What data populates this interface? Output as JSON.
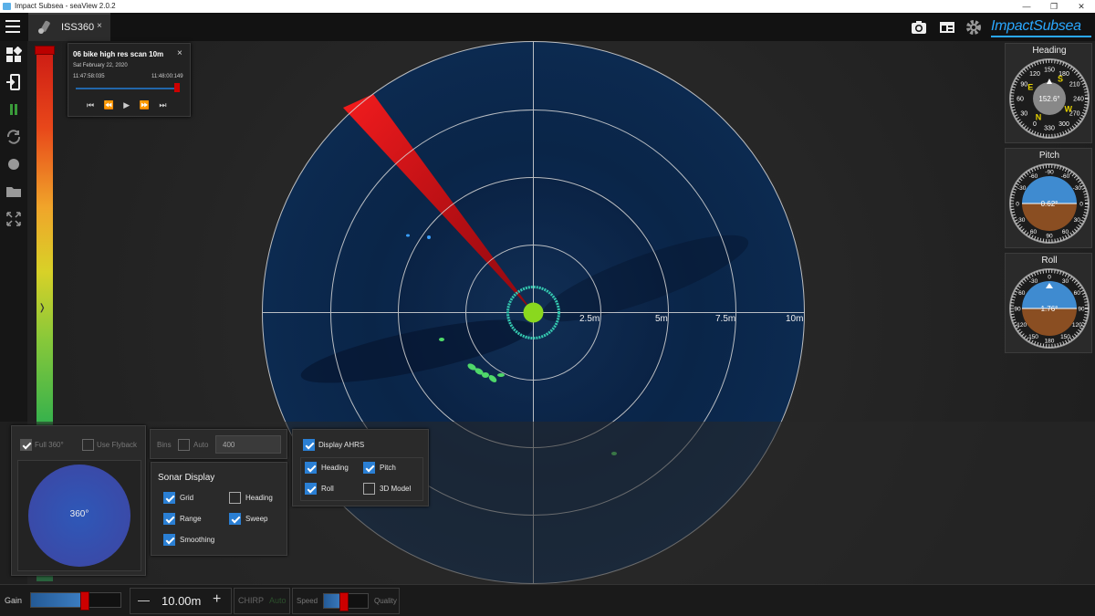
{
  "window": {
    "title": "Impact Subsea - seaView 2.0.2"
  },
  "tab": {
    "label": "ISS360",
    "close": "×"
  },
  "brand": {
    "name": "ImpactSubsea"
  },
  "player": {
    "title": "06 bike high res scan 10m",
    "date": "Sat February 22, 2020",
    "start_time": "11:47:58:035",
    "end_time": "11:48:00:149",
    "close": "×",
    "progress": 0.97,
    "controls": "⏮ ⏪ ▶ ⏩ ⏭"
  },
  "sonar": {
    "range_labels": [
      "2.5m",
      "5m",
      "7.5m",
      "10m"
    ],
    "sweep_color": "#cc1111"
  },
  "ahrs": {
    "heading": {
      "title": "Heading",
      "value": "152.6°",
      "ticks": [
        "120",
        "150",
        "180",
        "210",
        "240",
        "270",
        "300",
        "330",
        "0",
        "30",
        "60",
        "90"
      ],
      "cardinals": [
        "S",
        "W",
        "N",
        "E"
      ]
    },
    "pitch": {
      "title": "Pitch",
      "value": "0.62°",
      "ticks": [
        "-90",
        "-60",
        "-30",
        "0",
        "30",
        "60",
        "90"
      ]
    },
    "roll": {
      "title": "Roll",
      "value": "1.76°",
      "ticks": [
        "-30",
        "0",
        "30",
        "60",
        "90",
        "120",
        "150",
        "180",
        "150",
        "120",
        "90",
        "60"
      ]
    }
  },
  "scan_panel": {
    "full360_label": "Full 360°",
    "flyback_label": "Use Flyback",
    "sector_label": "360°"
  },
  "bins_panel": {
    "bins_label": "Bins",
    "auto_label": "Auto",
    "bins_value": "400"
  },
  "sonar_display": {
    "title": "Sonar Display",
    "items": [
      {
        "label": "Grid",
        "checked": true
      },
      {
        "label": "Heading",
        "checked": false
      },
      {
        "label": "Range",
        "checked": true
      },
      {
        "label": "Sweep",
        "checked": true
      },
      {
        "label": "Smoothing",
        "checked": true
      }
    ]
  },
  "ahrs_panel": {
    "display_label": "Display AHRS",
    "items": [
      {
        "label": "Heading",
        "checked": true
      },
      {
        "label": "Pitch",
        "checked": true
      },
      {
        "label": "Roll",
        "checked": true
      },
      {
        "label": "3D Model",
        "checked": false
      }
    ]
  },
  "bottom": {
    "gain_label": "Gain",
    "gain_level": 0.6,
    "range_minus": "—",
    "range_value": "10.00m",
    "range_plus": "+",
    "chirp_label": "CHIRP",
    "chirp_mode": "Auto",
    "speed_label": "Speed",
    "quality_label": "Quality",
    "speed_level": 0.45
  }
}
